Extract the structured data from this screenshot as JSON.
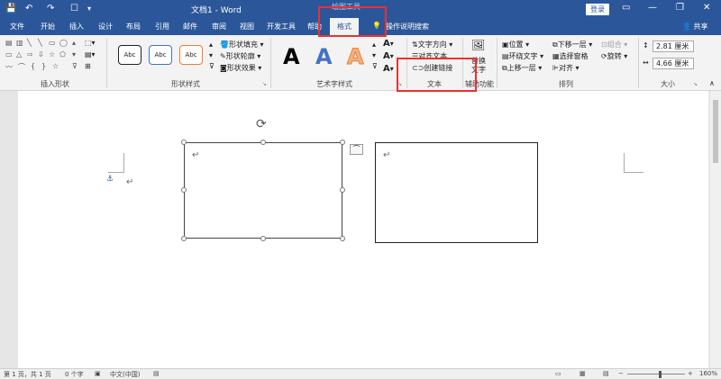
{
  "window": {
    "doc_title": "文档1 - Word",
    "context_tools": "绘图工具",
    "login_label": "登录",
    "restore_glyph": "▭",
    "minimize_glyph": "—",
    "maximize_glyph": "❐",
    "close_glyph": "✕"
  },
  "tabs": [
    {
      "label": "文件"
    },
    {
      "label": "开始"
    },
    {
      "label": "插入"
    },
    {
      "label": "设计"
    },
    {
      "label": "布局"
    },
    {
      "label": "引用"
    },
    {
      "label": "邮件"
    },
    {
      "label": "审阅"
    },
    {
      "label": "视图"
    },
    {
      "label": "开发工具"
    },
    {
      "label": "帮助"
    },
    {
      "label": "格式"
    }
  ],
  "tell_me": "操作说明搜索",
  "share_label": "共享",
  "ribbon": {
    "groups": {
      "insert_shapes": "插入形状",
      "shape_styles": "形状样式",
      "wordart_styles": "艺术字样式",
      "text": "文本",
      "accessibility": "辅助功能",
      "arrange": "排列",
      "size": "大小"
    },
    "style_samples": [
      "Abc",
      "Abc",
      "Abc"
    ],
    "shape_fill": "形状填充",
    "shape_outline": "形状轮廓",
    "shape_effects": "形状效果",
    "wordart_letters": [
      "A",
      "A",
      "A"
    ],
    "text_direction": "文字方向",
    "align_text": "对齐文本",
    "create_link": "创建链接",
    "alt_text_line1": "替换",
    "alt_text_line2": "文字",
    "position": "位置",
    "wrap_text": "环绕文字",
    "bring_forward": "上移一层",
    "send_backward": "下移一层",
    "selection_pane": "选择窗格",
    "align": "对齐",
    "group": "组合",
    "rotate": "旋转",
    "height": "2.81 厘米",
    "width": "4.66 厘米"
  },
  "document": {
    "paragraph_mark": "↵",
    "anchor_glyph": "⚓"
  },
  "statusbar": {
    "page": "第 1 页，共 1 页",
    "words": "0 个字",
    "language": "中文(中国)",
    "zoom": "160%"
  },
  "colors": {
    "titlebar": "#2b579a",
    "ribbon_bg": "#f3f3f3",
    "highlight": "#e8322f",
    "style1_border": "#222222",
    "style2_border": "#4472c4",
    "style3_border": "#ed7d31",
    "wordart1": "#000000",
    "wordart2": "#4472c4",
    "wordart3": "#f4b183"
  }
}
